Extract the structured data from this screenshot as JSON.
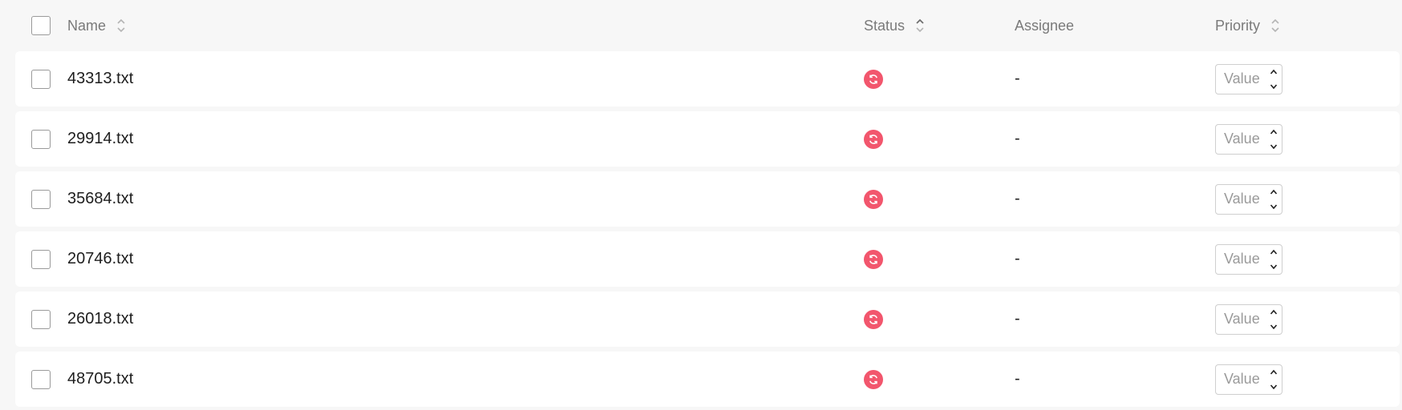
{
  "header": {
    "name": "Name",
    "status": "Status",
    "assignee": "Assignee",
    "priority": "Priority"
  },
  "rows": [
    {
      "name": "43313.txt",
      "assignee": "-",
      "priority_placeholder": "Value"
    },
    {
      "name": "29914.txt",
      "assignee": "-",
      "priority_placeholder": "Value"
    },
    {
      "name": "35684.txt",
      "assignee": "-",
      "priority_placeholder": "Value"
    },
    {
      "name": "20746.txt",
      "assignee": "-",
      "priority_placeholder": "Value"
    },
    {
      "name": "26018.txt",
      "assignee": "-",
      "priority_placeholder": "Value"
    },
    {
      "name": "48705.txt",
      "assignee": "-",
      "priority_placeholder": "Value"
    }
  ],
  "icons": {
    "status": "sync-icon",
    "sort": "sort-icon",
    "stepper_up": "chevron-up-icon",
    "stepper_down": "chevron-down-icon"
  },
  "colors": {
    "status_accent": "#f2566d",
    "background": "#f7f7f7",
    "row_background": "#ffffff"
  }
}
